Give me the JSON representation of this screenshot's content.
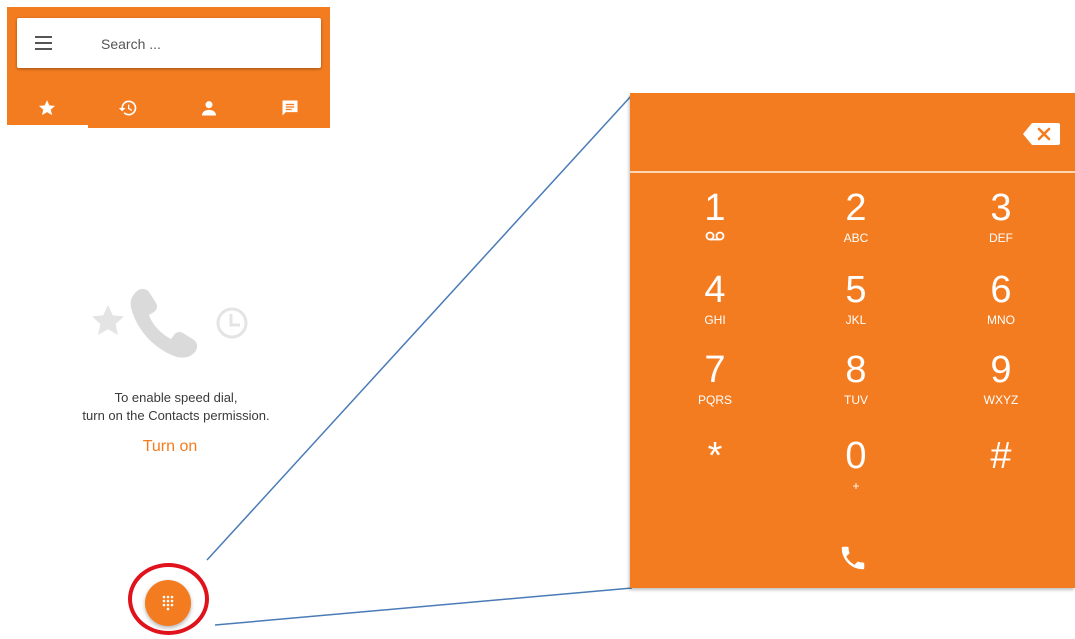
{
  "search": {
    "placeholder": "Search ..."
  },
  "tabs": [
    {
      "id": "speed-dial",
      "icon": "star-icon",
      "active": true
    },
    {
      "id": "recents",
      "icon": "history-icon",
      "active": false
    },
    {
      "id": "contacts",
      "icon": "person-icon",
      "active": false
    },
    {
      "id": "messages",
      "icon": "message-icon",
      "active": false
    }
  ],
  "empty_state": {
    "line1": "To enable speed dial,",
    "line2": "turn on the Contacts permission.",
    "action_label": "Turn on"
  },
  "dialpad": {
    "digits": "",
    "keys": [
      {
        "num": "1",
        "sub": ""
      },
      {
        "num": "2",
        "sub": "ABC"
      },
      {
        "num": "3",
        "sub": "DEF"
      },
      {
        "num": "4",
        "sub": "GHI"
      },
      {
        "num": "5",
        "sub": "JKL"
      },
      {
        "num": "6",
        "sub": "MNO"
      },
      {
        "num": "7",
        "sub": "PQRS"
      },
      {
        "num": "8",
        "sub": "TUV"
      },
      {
        "num": "9",
        "sub": "WXYZ"
      },
      {
        "num": "*",
        "sub": ""
      },
      {
        "num": "0",
        "sub": "+"
      },
      {
        "num": "#",
        "sub": ""
      }
    ]
  },
  "colors": {
    "accent": "#f47c20",
    "highlight": "#e0121b",
    "callout_line": "#4a7bb7"
  }
}
